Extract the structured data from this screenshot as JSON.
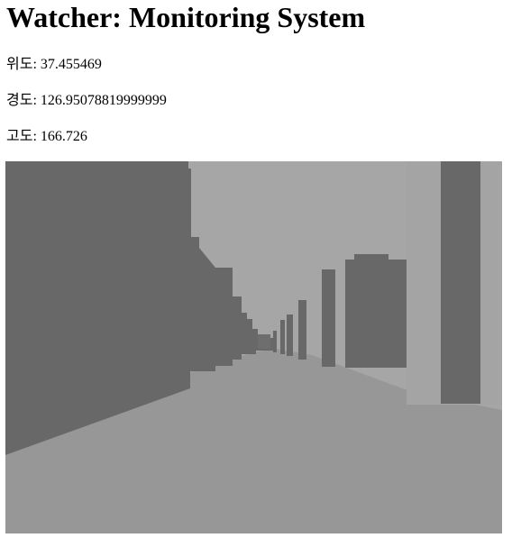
{
  "header": {
    "title": "Watcher: Monitoring System"
  },
  "telemetry": {
    "latitude": {
      "label": "위도:",
      "value": "37.455469"
    },
    "longitude": {
      "label": "경도:",
      "value": "126.95078819999999"
    },
    "altitude": {
      "label": "고도:",
      "value": "166.726"
    }
  },
  "scene": {
    "colors": {
      "sky": "#a6a6a6",
      "ground": "#979797",
      "building_dark": "#686868",
      "building_light": "#a4a4a4"
    }
  }
}
